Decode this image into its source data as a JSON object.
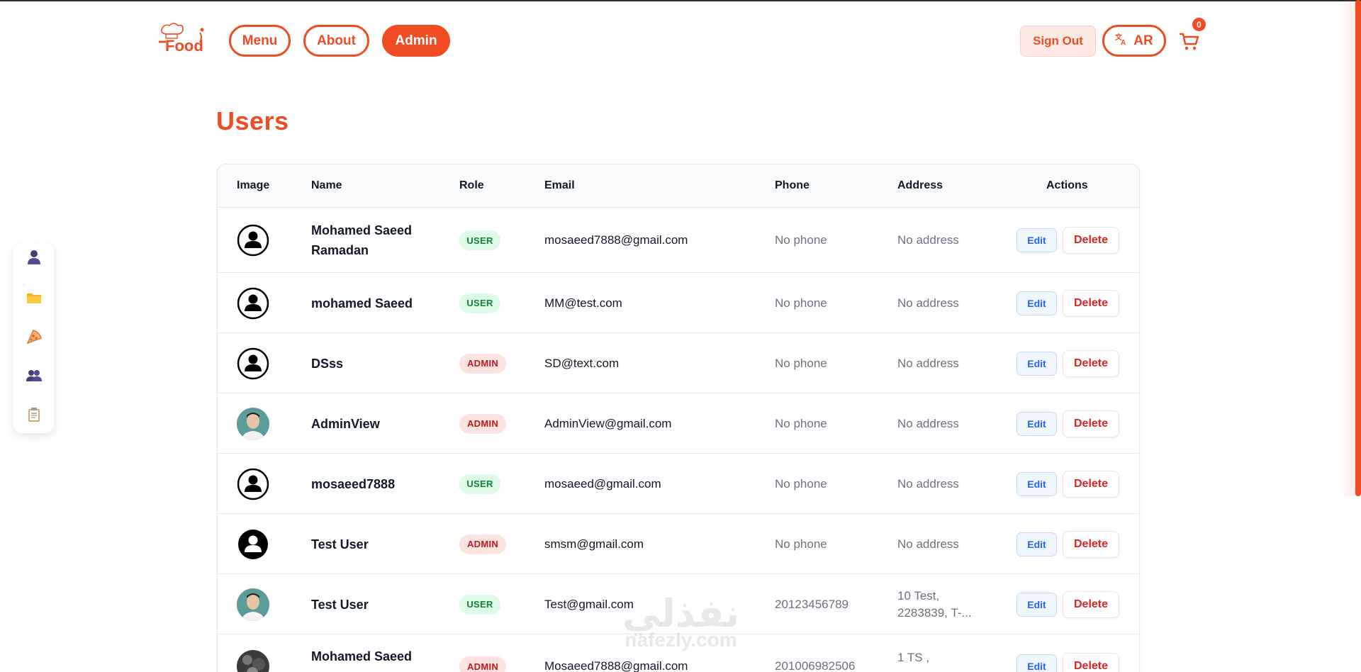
{
  "header": {
    "logo_text": "Food",
    "nav": [
      {
        "label": "Menu"
      },
      {
        "label": "About"
      },
      {
        "label": "Admin"
      }
    ],
    "signout_label": "Sign Out",
    "lang_label": "AR",
    "cart_count": "0"
  },
  "sidebar": {
    "items": [
      {
        "icon": "user-icon"
      },
      {
        "icon": "folder-icon"
      },
      {
        "icon": "pizza-icon"
      },
      {
        "icon": "users-icon"
      },
      {
        "icon": "clipboard-icon"
      }
    ]
  },
  "page": {
    "title": "Users"
  },
  "table": {
    "headers": {
      "image": "Image",
      "name": "Name",
      "role": "Role",
      "email": "Email",
      "phone": "Phone",
      "address": "Address",
      "actions": "Actions"
    },
    "rows": [
      {
        "avatar": "default",
        "name": "Mohamed Saeed Ramadan",
        "role": "USER",
        "email": "mosaeed7888@gmail.com",
        "phone": "No phone",
        "address": "No address",
        "edit": "Edit",
        "delete": "Delete"
      },
      {
        "avatar": "default",
        "name": "mohamed Saeed",
        "role": "USER",
        "email": "MM@test.com",
        "phone": "No phone",
        "address": "No address",
        "edit": "Edit",
        "delete": "Delete"
      },
      {
        "avatar": "default",
        "name": "DSss",
        "role": "ADMIN",
        "email": "SD@text.com",
        "phone": "No phone",
        "address": "No address",
        "edit": "Edit",
        "delete": "Delete"
      },
      {
        "avatar": "photo",
        "name": "AdminView",
        "role": "ADMIN",
        "email": "AdminView@gmail.com",
        "phone": "No phone",
        "address": "No address",
        "edit": "Edit",
        "delete": "Delete"
      },
      {
        "avatar": "default",
        "name": "mosaeed7888",
        "role": "USER",
        "email": "mosaeed@gmail.com",
        "phone": "No phone",
        "address": "No address",
        "edit": "Edit",
        "delete": "Delete"
      },
      {
        "avatar": "default-filled",
        "name": "Test User",
        "role": "ADMIN",
        "email": "smsm@gmail.com",
        "phone": "No phone",
        "address": "No address",
        "edit": "Edit",
        "delete": "Delete"
      },
      {
        "avatar": "photo",
        "name": "Test User",
        "role": "USER",
        "email": "Test@gmail.com",
        "phone": "20123456789",
        "address": "10 Test, 2283839, T-...",
        "edit": "Edit",
        "delete": "Delete"
      },
      {
        "avatar": "photo-dark",
        "name": "Mohamed Saeed",
        "role": "ADMIN",
        "email": "Mosaeed7888@gmail.com",
        "phone": "201006982506",
        "address": "1 TS ,",
        "edit": "Edit",
        "delete": "Delete"
      }
    ]
  },
  "watermark": {
    "line1": "نفذلي",
    "line2": "nafezly.com"
  },
  "colors": {
    "accent": "#f04c23",
    "user_badge": "#15803d",
    "admin_badge": "#b91c1c",
    "edit": "#2563eb",
    "delete": "#dc2626"
  }
}
